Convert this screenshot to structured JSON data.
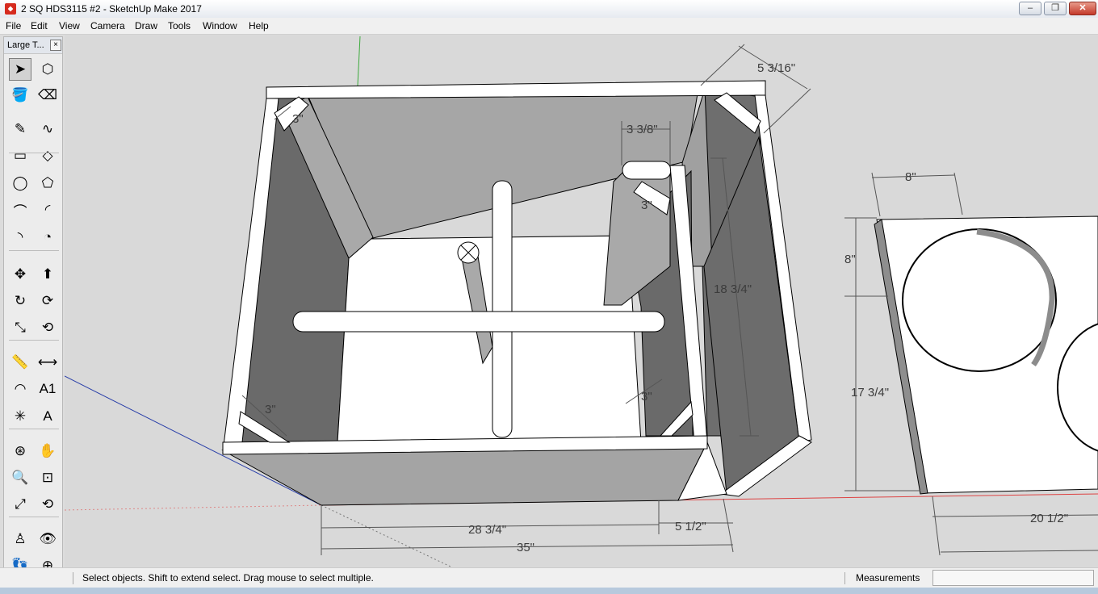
{
  "window": {
    "title": "2 SQ HDS3115 #2 - SketchUp Make 2017",
    "minimize_glyph": "–",
    "maximize_glyph": "❐",
    "close_glyph": "✕"
  },
  "menu": [
    {
      "label": "File"
    },
    {
      "label": "Edit"
    },
    {
      "label": "View"
    },
    {
      "label": "Camera"
    },
    {
      "label": "Draw"
    },
    {
      "label": "Tools"
    },
    {
      "label": "Window"
    },
    {
      "label": "Help"
    }
  ],
  "toolbar": {
    "title": "Large T...",
    "close_glyph": "×",
    "tools": [
      {
        "name": "select-icon",
        "glyph": "➤"
      },
      {
        "name": "make-component-icon",
        "glyph": "⬡"
      },
      {
        "name": "paint-bucket-icon",
        "glyph": "🪣"
      },
      {
        "name": "eraser-icon",
        "glyph": "⌫"
      },
      {
        "name": "line-icon",
        "glyph": "✎"
      },
      {
        "name": "freehand-icon",
        "glyph": "∿"
      },
      {
        "name": "rectangle-icon",
        "glyph": "▭"
      },
      {
        "name": "rotated-rectangle-icon",
        "glyph": "◇"
      },
      {
        "name": "circle-icon",
        "glyph": "◯"
      },
      {
        "name": "polygon-icon",
        "glyph": "⬠"
      },
      {
        "name": "arc-icon",
        "glyph": "⌒"
      },
      {
        "name": "two-point-arc-icon",
        "glyph": "◜"
      },
      {
        "name": "three-point-arc-icon",
        "glyph": "◝"
      },
      {
        "name": "pie-icon",
        "glyph": "◔"
      },
      {
        "name": "move-icon",
        "glyph": "✥"
      },
      {
        "name": "push-pull-icon",
        "glyph": "⬆"
      },
      {
        "name": "rotate-icon",
        "glyph": "↻"
      },
      {
        "name": "follow-me-icon",
        "glyph": "⟳"
      },
      {
        "name": "scale-icon",
        "glyph": "⤡"
      },
      {
        "name": "offset-icon",
        "glyph": "⟲"
      },
      {
        "name": "tape-measure-icon",
        "glyph": "📏"
      },
      {
        "name": "dimension-icon",
        "glyph": "⟷"
      },
      {
        "name": "protractor-icon",
        "glyph": "◠"
      },
      {
        "name": "text-icon",
        "glyph": "A1"
      },
      {
        "name": "axes-icon",
        "glyph": "✳"
      },
      {
        "name": "3d-text-icon",
        "glyph": "A"
      },
      {
        "name": "orbit-icon",
        "glyph": "⊛"
      },
      {
        "name": "pan-icon",
        "glyph": "✋"
      },
      {
        "name": "zoom-icon",
        "glyph": "🔍"
      },
      {
        "name": "zoom-window-icon",
        "glyph": "⊡"
      },
      {
        "name": "zoom-extents-icon",
        "glyph": "⤢"
      },
      {
        "name": "previous-view-icon",
        "glyph": "⟲"
      },
      {
        "name": "position-camera-icon",
        "glyph": "♙"
      },
      {
        "name": "look-around-icon",
        "glyph": "👁"
      },
      {
        "name": "walk-icon",
        "glyph": "👣"
      },
      {
        "name": "section-plane-icon",
        "glyph": "⊕"
      }
    ]
  },
  "dimensions": {
    "top_right_depth": "5 3/16\"",
    "port_width": "3 3/8\"",
    "brace_top_left": "3\"",
    "brace_port": "3\"",
    "brace_bottom_left": "3\"",
    "brace_bottom_right": "3\"",
    "inner_height": "18 3/4\"",
    "baffle_top_width": "8\"",
    "baffle_upper_height": "8\"",
    "baffle_lower_height": "17 3/4\"",
    "main_width": "28 3/4\"",
    "port_section_width": "5 1/2\"",
    "overall_width": "35\"",
    "baffle_width": "20 1/2\""
  },
  "status": {
    "hint": "Select objects. Shift to extend select. Drag mouse to select multiple.",
    "measurements_label": "Measurements",
    "measurements_value": ""
  }
}
